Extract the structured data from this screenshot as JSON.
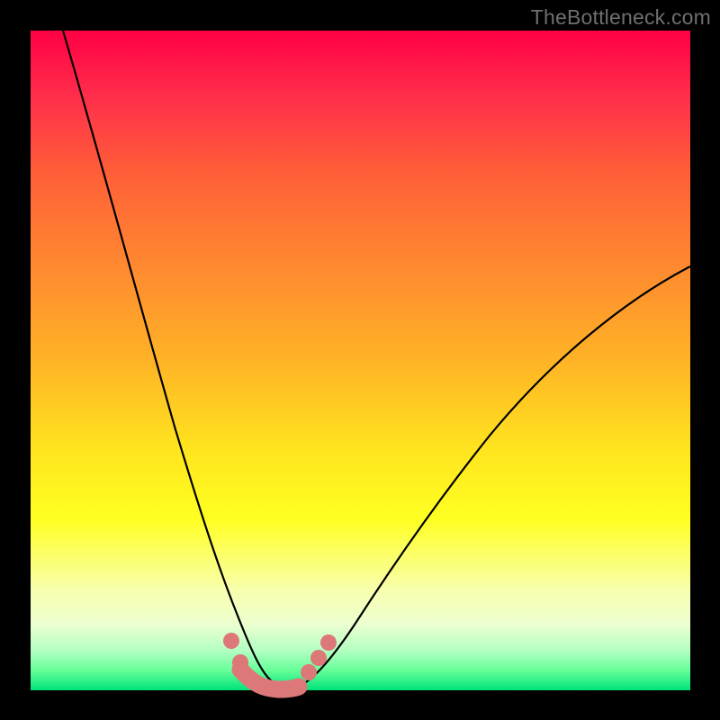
{
  "watermark": "TheBottleneck.com",
  "chart_data": {
    "type": "line",
    "title": "",
    "xlabel": "",
    "ylabel": "",
    "xlim": [
      0,
      100
    ],
    "ylim": [
      0,
      100
    ],
    "grid": false,
    "legend": false,
    "background_gradient": {
      "direction": "top-to-bottom",
      "stops": [
        {
          "pos": 0,
          "color": "#ff0044"
        },
        {
          "pos": 50,
          "color": "#ffb326"
        },
        {
          "pos": 74,
          "color": "#ffff22"
        },
        {
          "pos": 100,
          "color": "#00e27a"
        }
      ]
    },
    "series": [
      {
        "name": "left-curve",
        "x": [
          5,
          10,
          15,
          20,
          25,
          28,
          30,
          32,
          34,
          35
        ],
        "y": [
          100,
          78,
          56,
          36,
          18,
          10,
          6,
          3,
          1,
          0
        ]
      },
      {
        "name": "right-curve",
        "x": [
          40,
          42,
          45,
          50,
          55,
          60,
          70,
          80,
          90,
          100
        ],
        "y": [
          0,
          2,
          5,
          10,
          16,
          22,
          34,
          46,
          56,
          64
        ]
      }
    ],
    "markers": [
      {
        "x": 31,
        "y": 8
      },
      {
        "x": 32.5,
        "y": 4
      },
      {
        "x": 34,
        "y": 2
      },
      {
        "x": 36,
        "y": 1
      },
      {
        "x": 38,
        "y": 1.5
      },
      {
        "x": 41,
        "y": 3.5
      },
      {
        "x": 42.5,
        "y": 5.5
      },
      {
        "x": 44,
        "y": 8
      }
    ],
    "marker_color": "#e17373",
    "marker_radius": 2,
    "bottom_segment": {
      "from_x": 32.5,
      "to_x": 40,
      "y": 1,
      "thickness": 3,
      "color": "#e17373"
    }
  }
}
